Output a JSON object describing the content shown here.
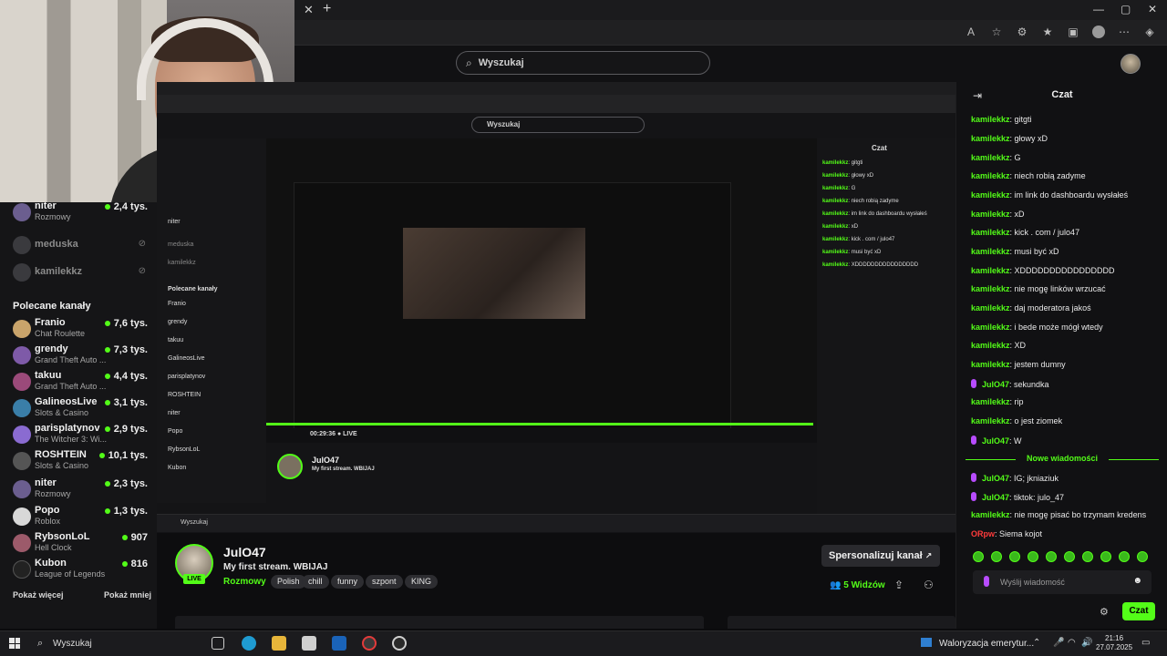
{
  "browser": {
    "close_glyph": "✕",
    "new_tab_glyph": "+",
    "window_controls": [
      "—",
      "▢",
      "✕"
    ],
    "toolbar_icons": [
      "read-aloud-icon",
      "favorite-star-icon",
      "extensions-icon",
      "favorites-icon",
      "collections-icon",
      "profile-icon",
      "more-icon",
      "copilot-icon"
    ]
  },
  "header": {
    "search_placeholder": "Wyszukaj",
    "search_icon": "search-icon"
  },
  "sidebar": {
    "following": [
      {
        "name": "niter",
        "category": "Rozmowy",
        "viewers": "2,4 tys.",
        "live": true,
        "avatar_color": "#6b5e8f"
      },
      {
        "name": "meduska",
        "category": "",
        "viewers": "",
        "live": false,
        "avatar_color": "#3a3a3e"
      },
      {
        "name": "kamilekkz",
        "category": "",
        "viewers": "",
        "live": false,
        "avatar_color": "#3a3a3e"
      }
    ],
    "section_title": "Polecane kanały",
    "recommended": [
      {
        "name": "Franio",
        "category": "Chat Roulette",
        "viewers": "7,6 tys.",
        "avatar_color": "#c9a46b"
      },
      {
        "name": "grendy",
        "category": "Grand Theft Auto ...",
        "viewers": "7,3 tys.",
        "avatar_color": "#7e5aa8"
      },
      {
        "name": "takuu",
        "category": "Grand Theft Auto ...",
        "viewers": "4,4 tys.",
        "avatar_color": "#9b4a7a"
      },
      {
        "name": "GalineosLive",
        "category": "Slots & Casino",
        "viewers": "3,1 tys.",
        "avatar_color": "#3a7ea8"
      },
      {
        "name": "parisplatynov",
        "category": "The Witcher 3: Wi...",
        "viewers": "2,9 tys.",
        "avatar_color": "#8a6bd1"
      },
      {
        "name": "ROSHTEIN",
        "category": "Slots & Casino",
        "viewers": "10,1 tys.",
        "avatar_color": "#555555"
      },
      {
        "name": "niter",
        "category": "Rozmowy",
        "viewers": "2,3 tys.",
        "avatar_color": "#6b5e8f"
      },
      {
        "name": "Popo",
        "category": "Roblox",
        "viewers": "1,3 tys.",
        "avatar_color": "#d8d8d8"
      },
      {
        "name": "RybsonLoL",
        "category": "Hell Clock",
        "viewers": "907",
        "avatar_color": "#9c5a6a"
      },
      {
        "name": "Kubon",
        "category": "League of Legends",
        "viewers": "816",
        "avatar_color": "#222222"
      }
    ],
    "show_more": "Pokaż więcej",
    "show_less": "Pokaż mniej"
  },
  "channel": {
    "name": "JulO47",
    "title": "My first stream. WBIJAJ",
    "category": "Rozmowy",
    "tags": [
      "Polish",
      "chill",
      "funny",
      "szpont",
      "KING"
    ],
    "live_label": "LIVE",
    "personalize_label": "Spersonalizuj kanał",
    "viewers_count": "5",
    "viewers_label": "Widzów"
  },
  "nested": {
    "search": "Wyszukaj",
    "time": "00:29:36",
    "live": "LIVE",
    "sidebar_lines": [
      "niter",
      "meduska",
      "kamilekkz",
      "Polecane kanały",
      "Franio",
      "grendy",
      "takuu",
      "GalineosLive",
      "parisplatynov",
      "ROSHTEIN",
      "niter",
      "Popo",
      "RybsonLoL",
      "Kubon"
    ],
    "chat_title": "Czat",
    "taskbar_search": "Wyszukaj"
  },
  "chat": {
    "title": "Czat",
    "messages": [
      {
        "user": "kamilekkz",
        "text": "gitgti",
        "badge": false
      },
      {
        "user": "kamilekkz",
        "text": "głowy xD",
        "badge": false
      },
      {
        "user": "kamilekkz",
        "text": "G",
        "badge": false
      },
      {
        "user": "kamilekkz",
        "text": "niech robią zadyme",
        "badge": false
      },
      {
        "user": "kamilekkz",
        "text": "im link do dashboardu wysłałeś",
        "badge": false
      },
      {
        "user": "kamilekkz",
        "text": "xD",
        "badge": false
      },
      {
        "user": "kamilekkz",
        "text": "kick . com / julo47",
        "badge": false
      },
      {
        "user": "kamilekkz",
        "text": "musi być xD",
        "badge": false
      },
      {
        "user": "kamilekkz",
        "text": "XDDDDDDDDDDDDDDDD",
        "badge": false
      },
      {
        "user": "kamilekkz",
        "text": "nie mogę linków wrzucać",
        "badge": false
      },
      {
        "user": "kamilekkz",
        "text": "daj moderatora jakoś",
        "badge": false
      },
      {
        "user": "kamilekkz",
        "text": "i bede może mógł wtedy",
        "badge": false
      },
      {
        "user": "kamilekkz",
        "text": "XD",
        "badge": false
      },
      {
        "user": "kamilekkz",
        "text": "jestem dumny",
        "badge": false
      },
      {
        "user": "JulO47",
        "text": "sekundka",
        "badge": true
      },
      {
        "user": "kamilekkz",
        "text": "rip",
        "badge": false
      },
      {
        "user": "kamilekkz",
        "text": "o jest ziomek",
        "badge": false
      },
      {
        "user": "JulO47",
        "text": "W",
        "badge": true
      }
    ],
    "new_messages_label": "Nowe wiadomości",
    "new_messages": [
      {
        "user": "JulO47",
        "text": "IG; jkniaziuk",
        "badge": true,
        "red": false
      },
      {
        "user": "JulO47",
        "text": "tiktok: julo_47",
        "badge": true,
        "red": false
      },
      {
        "user": "kamilekkz",
        "text": "nie mogę pisać bo trzymam kredens",
        "badge": false,
        "red": false
      },
      {
        "user": "ORpw",
        "text": "Siema kojot",
        "badge": false,
        "red": true
      }
    ],
    "input_placeholder": "Wyślij wiadomość",
    "send_label": "Czat"
  },
  "taskbar": {
    "search": "Wyszukaj",
    "news": "Waloryzacja emerytur...",
    "time": "21:16",
    "date": "27.07.2025"
  }
}
